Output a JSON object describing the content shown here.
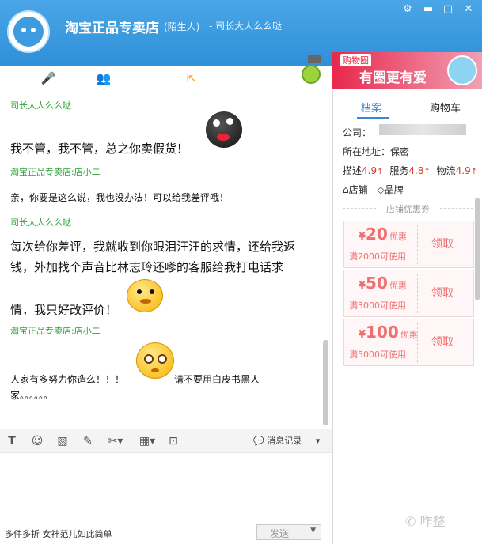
{
  "header": {
    "shop_name": "淘宝正品专卖店",
    "relation_tag": "(陌生人)",
    "subtitle": "- 司长大人么么哒",
    "window_controls": [
      "gear-icon",
      "minimize-icon",
      "maximize-icon",
      "close-icon"
    ]
  },
  "toolbar": {
    "icons": [
      "transfer-icon",
      "microphone-icon",
      "target-icon",
      "contacts-icon",
      "screen-share-icon",
      "robot-icon",
      "export-icon"
    ]
  },
  "ad": {
    "small_text": "购物圈",
    "big_text": "有圈更有爱"
  },
  "chat": {
    "messages": [
      {
        "sender": "司长大人么么哒",
        "text": "我不管，我不管，总之你卖假货！"
      },
      {
        "sender": "淘宝正品专卖店:店小二",
        "text": "亲，你要是这么说，我也没办法！可以给我差评哦！"
      },
      {
        "sender": "司长大人么么哒",
        "lines": [
          "每次给你差评，我就收到你眼泪汪汪的求情，还给我返",
          "钱，外加找个声音比林志玲还嗲的客服给我打电话求",
          "情，我只好改评价！"
        ]
      },
      {
        "sender": "淘宝正品专卖店:店小二",
        "lines": [
          "人家有多努力你造么！！！",
          "请不要用白皮书黑人",
          "家。。。。。。"
        ]
      }
    ]
  },
  "input_toolbar": {
    "tools": [
      "font-icon",
      "emoji-icon",
      "image-icon",
      "edit-icon",
      "scissors-icon",
      "calculator-icon",
      "screen-icon"
    ],
    "history_label": "消息记录"
  },
  "bottom": {
    "marquee": "多件多折 女神范儿如此简单",
    "send_label": "发送"
  },
  "right_panel": {
    "tabs": [
      "档案",
      "购物车"
    ],
    "company_label": "公司：",
    "location_label": "所在地址：",
    "location_value": "保密",
    "scores": [
      {
        "label": "描述",
        "value": "4.9"
      },
      {
        "label": "服务",
        "value": "4.8"
      },
      {
        "label": "物流",
        "value": "4.9"
      }
    ],
    "shop_link": "店铺",
    "brand_link": "品牌",
    "coupon_title": "店铺优惠券",
    "coupons": [
      {
        "currency": "¥",
        "amount": "20",
        "tag": "优惠",
        "condition": "满2000可使用",
        "button": "领取"
      },
      {
        "currency": "¥",
        "amount": "50",
        "tag": "优惠",
        "condition": "满3000可使用",
        "button": "领取"
      },
      {
        "currency": "¥",
        "amount": "100",
        "tag": "优惠",
        "condition": "满5000可使用",
        "button": "领取"
      }
    ]
  },
  "watermark": "咋整",
  "colors": {
    "title_bar": "#3b9be0",
    "sender_green": "#2fa13a",
    "tab_active": "#3a86d6",
    "coupon_red": "#f07070"
  }
}
